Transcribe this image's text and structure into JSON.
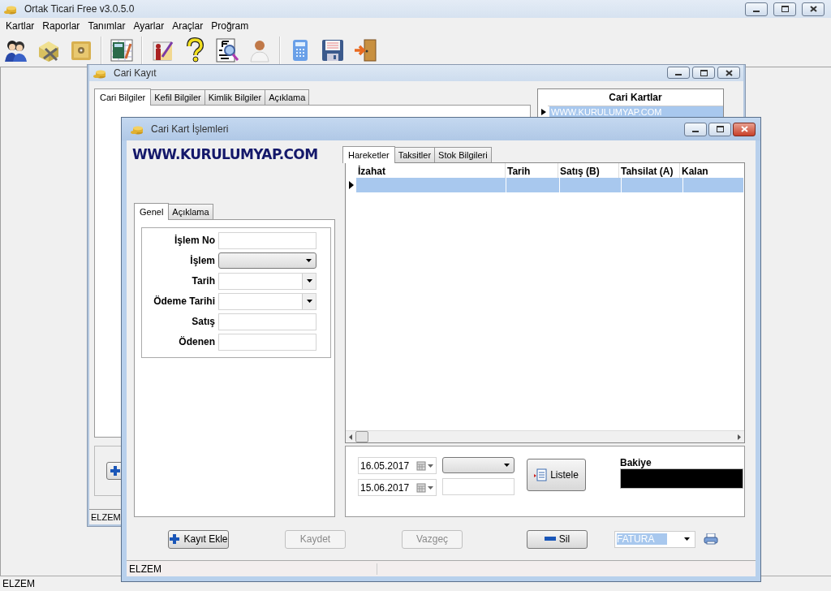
{
  "app": {
    "title": "Ortak Ticari Free v3.0.5.0"
  },
  "menu": [
    "Kartlar",
    "Raporlar",
    "Tanımlar",
    "Ayarlar",
    "Araçlar",
    "Proğram"
  ],
  "back_window": {
    "title": "Cari Kayıt",
    "tabs": [
      {
        "label": "Cari Bilgiler",
        "selected": true
      },
      {
        "label": "Kefil Bilgiler",
        "selected": false
      },
      {
        "label": "Kimlik Bilgiler",
        "selected": false
      },
      {
        "label": "Açıklama",
        "selected": false
      }
    ],
    "list_header": "Cari Kartlar",
    "list_row": {
      "text": "WWW.KURULUMYAP.COM",
      "selected": true
    },
    "status": "ELZEM"
  },
  "front_window": {
    "title": "Cari Kart İşlemleri",
    "banner": "WWW.KURULUMYAP.COM",
    "left_tabs": [
      {
        "label": "Genel",
        "selected": true
      },
      {
        "label": "Açıklama",
        "selected": false
      }
    ],
    "fields": [
      {
        "label": "İşlem No",
        "kind": "text"
      },
      {
        "label": "İşlem",
        "kind": "combo"
      },
      {
        "label": "Tarih",
        "kind": "date"
      },
      {
        "label": "Ödeme Tarihi",
        "kind": "date"
      },
      {
        "label": "Satış",
        "kind": "text"
      },
      {
        "label": "Ödenen",
        "kind": "text"
      }
    ],
    "right_tabs": [
      {
        "label": "Hareketler",
        "selected": true
      },
      {
        "label": "Taksitler",
        "selected": false
      },
      {
        "label": "Stok Bilgileri",
        "selected": false
      }
    ],
    "grid": {
      "columns": [
        "İzahat",
        "Tarih",
        "Satış (B)",
        "Tahsilat (A)",
        "Kalan"
      ],
      "rows": [
        {
          "selected": true
        }
      ]
    },
    "filter": {
      "date_from": "16.05.2017",
      "date_to": "15.06.2017",
      "list_button": "Listele",
      "balance_label": "Bakiye"
    },
    "buttons": [
      {
        "label": "Kayıt Ekle",
        "kind": "add",
        "disabled": false
      },
      {
        "label": "Kaydet",
        "kind": "plain",
        "disabled": true
      },
      {
        "label": "Vazgeç",
        "kind": "plain",
        "disabled": true
      },
      {
        "label": "Sil",
        "kind": "remove",
        "disabled": false
      }
    ],
    "report_combo": {
      "value": "FATURA"
    },
    "status": "ELZEM"
  },
  "status_bar": "ELZEM"
}
